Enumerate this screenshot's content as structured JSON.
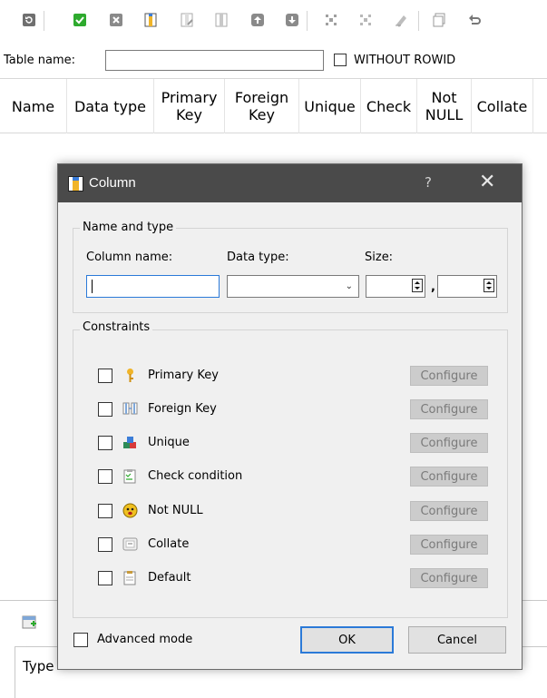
{
  "editor": {
    "table_name_label": "Table name:",
    "table_name_value": "",
    "without_rowid_label": "WITHOUT ROWID",
    "columns": [
      "Name",
      "Data type",
      "Primary Key",
      "Foreign Key",
      "Unique",
      "Check",
      "Not NULL",
      "Collate"
    ],
    "lower_header": "Type"
  },
  "toolbar": {
    "icons": [
      "refresh-icon",
      "commit-icon",
      "rollback-icon",
      "add-column-icon",
      "edit-column-icon",
      "delete-column-icon",
      "move-up-icon",
      "move-down-icon",
      "add-constraint-icon",
      "edit-constraint-icon",
      "delete-constraint-icon",
      "ddl-icon",
      "undo-icon"
    ]
  },
  "dialog": {
    "title": "Column",
    "help": "?",
    "close": "✕",
    "name_type_group": "Name and type",
    "column_name_label": "Column name:",
    "column_name_value": "",
    "data_type_label": "Data type:",
    "data_type_value": "",
    "size_label": "Size:",
    "size_separator": ",",
    "constraints_group": "Constraints",
    "constraints": [
      {
        "label": "Primary Key",
        "icon": "key-icon",
        "configure": "Configure"
      },
      {
        "label": "Foreign Key",
        "icon": "foreign-key-icon",
        "configure": "Configure"
      },
      {
        "label": "Unique",
        "icon": "unique-icon",
        "configure": "Configure"
      },
      {
        "label": "Check condition",
        "icon": "check-condition-icon",
        "configure": "Configure"
      },
      {
        "label": "Not NULL",
        "icon": "not-null-icon",
        "configure": "Configure"
      },
      {
        "label": "Collate",
        "icon": "collate-icon",
        "configure": "Configure"
      },
      {
        "label": "Default",
        "icon": "default-icon",
        "configure": "Configure"
      }
    ],
    "advanced_mode_label": "Advanced mode",
    "ok_label": "OK",
    "cancel_label": "Cancel"
  },
  "colors": {
    "titlebar": "#4a4a4a",
    "dialog_bg": "#f0f0f0",
    "focus_blue": "#2b7ad8",
    "disabled_btn": "#cccccc"
  }
}
